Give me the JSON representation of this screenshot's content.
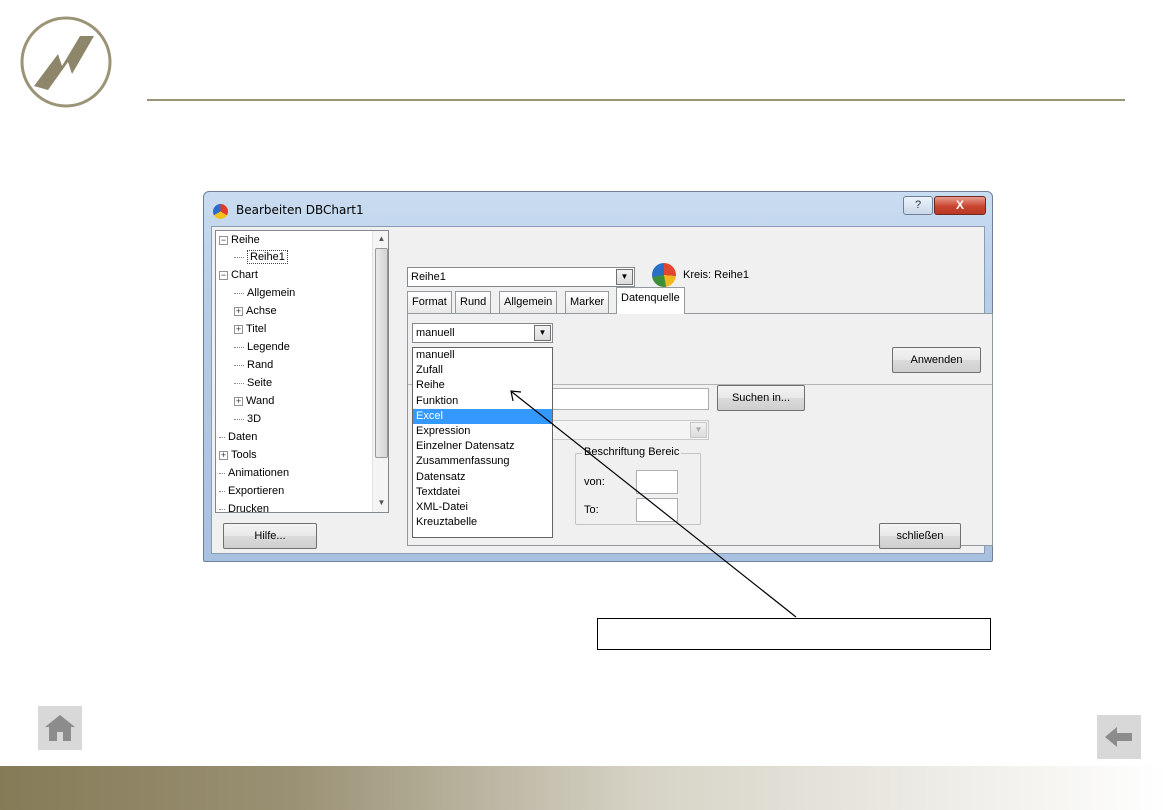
{
  "colors": {
    "accent_olive": "#9c9477",
    "selection": "#3399ff",
    "close_red": "#c9452f"
  },
  "icons": {
    "logo": "company-logo-icon",
    "home": "home-icon",
    "back": "back-arrow-icon",
    "series": "pie-chart-icon"
  },
  "dialog": {
    "title": "Bearbeiten DBChart1",
    "help_glyph": "?",
    "close_glyph": "X"
  },
  "tree": {
    "items": [
      {
        "label": "Reihe",
        "expander": "−"
      },
      {
        "label": "Reihe1"
      },
      {
        "label": "Chart",
        "expander": "−"
      },
      {
        "label": "Allgemein"
      },
      {
        "label": "Achse",
        "expander": "+"
      },
      {
        "label": "Titel",
        "expander": "+"
      },
      {
        "label": "Legende"
      },
      {
        "label": "Rand"
      },
      {
        "label": "Seite"
      },
      {
        "label": "Wand",
        "expander": "+"
      },
      {
        "label": "3D"
      },
      {
        "label": "Daten"
      },
      {
        "label": "Tools",
        "expander": "+"
      },
      {
        "label": "Animationen"
      },
      {
        "label": "Exportieren"
      },
      {
        "label": "Drucken"
      }
    ]
  },
  "series_select": {
    "value": "Reihe1"
  },
  "series_label": "Kreis: Reihe1",
  "tabs": [
    {
      "label": "Format"
    },
    {
      "label": "Rund"
    },
    {
      "label": "Allgemein"
    },
    {
      "label": "Marker"
    },
    {
      "label": "Datenquelle",
      "active": true
    }
  ],
  "source_select": {
    "value": "manuell",
    "options": [
      "manuell",
      "Zufall",
      "Reihe",
      "Funktion",
      "Excel",
      "Expression",
      "Einzelner Datensatz",
      "Zusammenfassung",
      "Datensatz",
      "Textdatei",
      "XML-Datei",
      "Kreuztabelle"
    ],
    "highlighted": "Excel"
  },
  "buttons": {
    "apply": "Anwenden",
    "browse": "Suchen in...",
    "help": "Hilfe...",
    "close": "schließen"
  },
  "label_range": {
    "title": "Beschriftung Bereic",
    "from_label": "von:",
    "to_label": "To:",
    "from_value": "",
    "to_value": ""
  },
  "callout": {
    "text": ""
  }
}
